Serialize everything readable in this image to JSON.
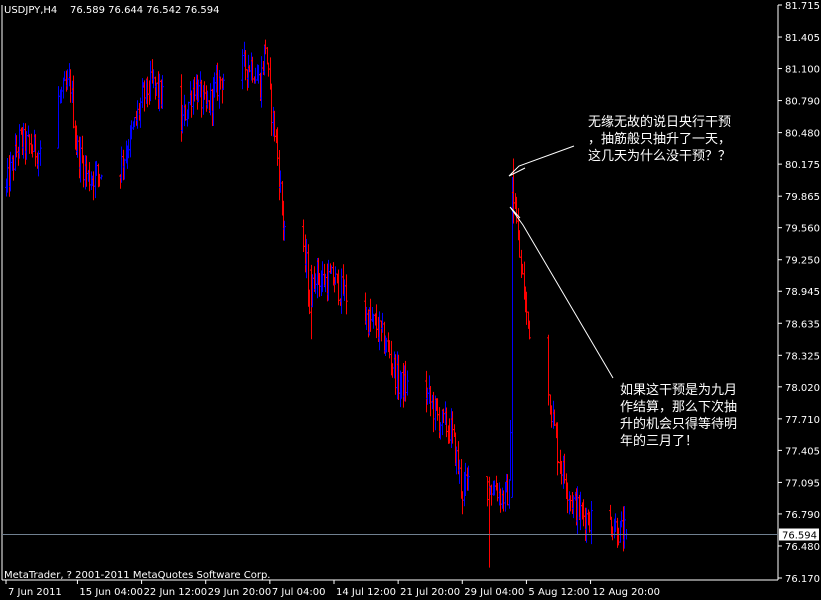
{
  "header": {
    "symbol": "USDJPY,H4",
    "ohlc": "76.589 76.644 76.542 76.594"
  },
  "copyright": "MetaTrader, ? 2001-2011 MetaQuotes Software Corp.",
  "annotations": [
    {
      "lines": [
        "无缘无故的说日央行干预",
        "，抽筋般只抽升了一天，",
        "这几天为什么没干预？？"
      ]
    },
    {
      "lines": [
        "如果这干预是为九月",
        "作结算，那么下次抽",
        "升的机会只得等待明",
        "年的三月了！"
      ]
    }
  ],
  "colors": {
    "background": "#000000",
    "bull": "#0000ff",
    "bear": "#ff0000",
    "axis": "#ffffff",
    "price_line": "#708090"
  },
  "chart_data": {
    "type": "bar",
    "title": "USDJPY,H4",
    "y_axis_position": "right",
    "current_price": 76.594,
    "ylim": [
      76.17,
      81.715
    ],
    "y_ticks": [
      "81.715",
      "81.405",
      "81.100",
      "80.790",
      "80.480",
      "80.175",
      "79.865",
      "79.560",
      "79.250",
      "78.945",
      "78.635",
      "78.325",
      "78.020",
      "77.710",
      "77.405",
      "77.095",
      "76.790",
      "76.480",
      "76.170"
    ],
    "x_ticks": [
      "7 Jun 2011",
      "15 Jun 04:00",
      "22 Jun 12:00",
      "29 Jun 20:00",
      "7 Jul 04:00",
      "14 Jul 12:00",
      "21 Jul 20:00",
      "29 Jul 04:00",
      "5 Aug 12:00",
      "12 Aug 20:00"
    ],
    "x_range": [
      "2011-06-07 00:00",
      "2011-08-17 00:00"
    ],
    "interval_hours": 4,
    "close_anchors": [
      [
        "2011-06-07 00:00",
        79.95
      ],
      [
        "2011-06-08 12:00",
        80.4
      ],
      [
        "2011-06-10 16:00",
        80.3
      ],
      [
        "2011-06-13 00:00",
        80.8
      ],
      [
        "2011-06-14 08:00",
        80.95
      ],
      [
        "2011-06-15 00:00",
        80.35
      ],
      [
        "2011-06-16 08:00",
        80.05
      ],
      [
        "2011-06-20 00:00",
        80.15
      ],
      [
        "2011-06-21 12:00",
        80.5
      ],
      [
        "2011-06-22 12:00",
        80.8
      ],
      [
        "2011-06-23 16:00",
        80.95
      ],
      [
        "2011-06-27 00:00",
        80.55
      ],
      [
        "2011-06-28 12:00",
        80.95
      ],
      [
        "2011-06-29 20:00",
        80.7
      ],
      [
        "2011-06-30 16:00",
        80.85
      ],
      [
        "2011-07-01 12:00",
        81.0
      ],
      [
        "2011-07-05 00:00",
        81.15
      ],
      [
        "2011-07-06 00:00",
        80.95
      ],
      [
        "2011-07-06 16:00",
        81.35
      ],
      [
        "2011-07-07 04:00",
        80.8
      ],
      [
        "2011-07-07 20:00",
        80.4
      ],
      [
        "2011-07-08 16:00",
        79.6
      ],
      [
        "2011-07-11 08:00",
        79.2
      ],
      [
        "2011-07-11 16:00",
        78.8
      ],
      [
        "2011-07-12 08:00",
        79.15
      ],
      [
        "2011-07-13 00:00",
        79.05
      ],
      [
        "2011-07-14 12:00",
        79.05
      ],
      [
        "2011-07-15 08:00",
        78.95
      ],
      [
        "2011-07-18 00:00",
        78.7
      ],
      [
        "2011-07-19 08:00",
        78.6
      ],
      [
        "2011-07-20 20:00",
        78.35
      ],
      [
        "2011-07-21 20:00",
        78.05
      ],
      [
        "2011-07-25 00:00",
        77.95
      ],
      [
        "2011-07-26 12:00",
        77.7
      ],
      [
        "2011-07-27 20:00",
        77.6
      ],
      [
        "2011-07-28 16:00",
        77.25
      ],
      [
        "2011-07-29 04:00",
        77.0
      ],
      [
        "2011-07-29 20:00",
        77.1
      ],
      [
        "2011-08-02 00:00",
        77.05
      ],
      [
        "2011-08-02 16:00",
        76.95
      ],
      [
        "2011-08-03 12:00",
        77.0
      ],
      [
        "2011-08-04 04:00",
        79.8
      ],
      [
        "2011-08-04 12:00",
        79.4
      ],
      [
        "2011-08-05 12:00",
        78.7
      ],
      [
        "2011-08-08 04:00",
        77.9
      ],
      [
        "2011-08-09 00:00",
        77.4
      ],
      [
        "2011-08-10 12:00",
        76.95
      ],
      [
        "2011-08-11 12:00",
        76.8
      ],
      [
        "2011-08-12 20:00",
        76.75
      ],
      [
        "2011-08-15 08:00",
        76.7
      ],
      [
        "2011-08-16 04:00",
        76.62
      ],
      [
        "2011-08-16 20:00",
        76.594
      ]
    ],
    "notable_bars": [
      {
        "time": "2011-07-11 20:00",
        "open": 79.15,
        "high": 79.2,
        "low": 78.48,
        "close": 78.8
      },
      {
        "time": "2011-08-01 04:00",
        "open": 77.1,
        "high": 77.15,
        "low": 76.27,
        "close": 77.05
      },
      {
        "time": "2011-08-03 20:00",
        "open": 76.95,
        "high": 80.05,
        "low": 76.95,
        "close": 79.9
      },
      {
        "time": "2011-08-04 00:00",
        "open": 79.9,
        "high": 80.23,
        "low": 79.6,
        "close": 79.8
      }
    ]
  }
}
